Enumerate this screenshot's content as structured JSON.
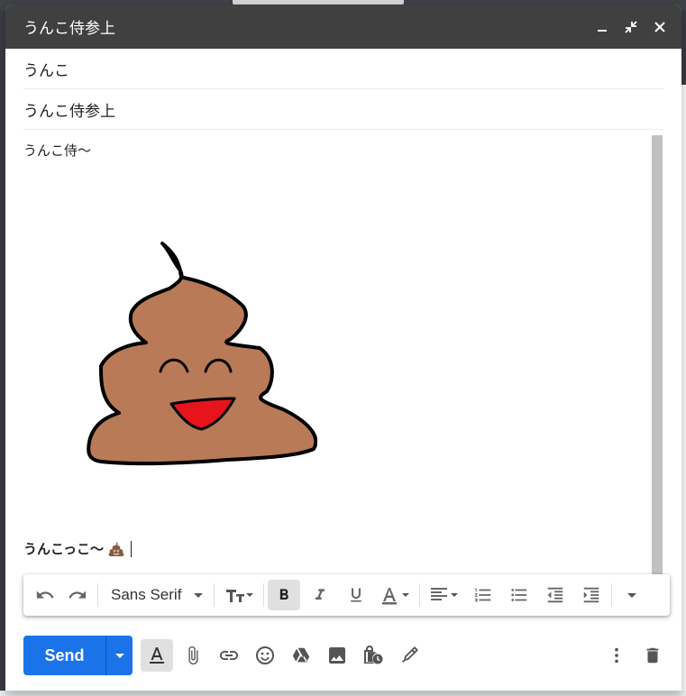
{
  "compose": {
    "title": "うんこ侍参上",
    "to_value": "うんこ",
    "subject_value": "うんこ侍参上",
    "body_text": "うんこ侍〜",
    "signature_text": "うんこっこ〜"
  },
  "format_bar": {
    "font_family": "Sans Serif",
    "buttons": [
      "undo",
      "redo",
      "font-family",
      "text-size",
      "bold",
      "italic",
      "underline",
      "text-color",
      "align",
      "numbered-list",
      "bulleted-list",
      "indent-less",
      "indent-more",
      "more-formatting"
    ]
  },
  "bottom_bar": {
    "send_label": "Send"
  },
  "colors": {
    "title_bar": "#404040",
    "send_button": "#1a73e8",
    "poop_fill": "#b87a57",
    "mouth_fill": "#e8141c"
  }
}
